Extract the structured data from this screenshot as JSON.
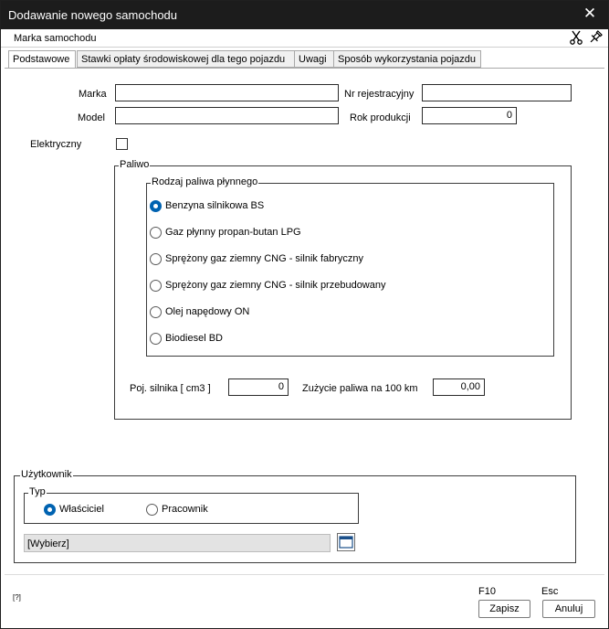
{
  "window": {
    "title": "Dodawanie nowego samochodu"
  },
  "subheader": {
    "label": "Marka samochodu"
  },
  "tabs": [
    {
      "label": "Podstawowe",
      "active": true
    },
    {
      "label": "Stawki opłaty środowiskowej dla tego pojazdu",
      "active": false
    },
    {
      "label": "Uwagi",
      "active": false
    },
    {
      "label": "Sposób wykorzystania pojazdu",
      "active": false
    }
  ],
  "form": {
    "marka_label": "Marka",
    "marka_value": "",
    "model_label": "Model",
    "model_value": "",
    "nr_rej_label": "Nr rejestracyjny",
    "nr_rej_value": "",
    "rok_label": "Rok produkcji",
    "rok_value": "0",
    "elektryczny_label": "Elektryczny",
    "elektryczny_checked": false
  },
  "paliwo": {
    "legend": "Paliwo",
    "rodzaj_legend": "Rodzaj paliwa płynnego",
    "options": [
      {
        "label": "Benzyna silnikowa BS",
        "checked": true
      },
      {
        "label": "Gaz płynny propan-butan LPG",
        "checked": false
      },
      {
        "label": "Sprężony gaz ziemny CNG - silnik fabryczny",
        "checked": false
      },
      {
        "label": "Sprężony gaz ziemny CNG - silnik przebudowany",
        "checked": false
      },
      {
        "label": "Olej napędowy ON",
        "checked": false
      },
      {
        "label": "Biodiesel BD",
        "checked": false
      }
    ],
    "poj_label": "Poj. silnika [ cm3 ]",
    "poj_value": "0",
    "zuzycie_label": "Zużycie paliwa na 100 km",
    "zuzycie_value": "0,00"
  },
  "uzytkownik": {
    "legend": "Użytkownik",
    "typ_legend": "Typ",
    "options": [
      {
        "label": "Właściciel",
        "checked": true
      },
      {
        "label": "Pracownik",
        "checked": false
      }
    ],
    "select_value": "[Wybierz]"
  },
  "footer": {
    "hint": "[?]",
    "save_hotkey": "F10",
    "save_label": "Zapisz",
    "cancel_hotkey": "Esc",
    "cancel_label": "Anuluj"
  },
  "icons": {
    "close": "close-icon",
    "scissors": "scissors-icon",
    "pin": "pin-icon",
    "picker": "window-picker-icon"
  },
  "colors": {
    "titlebar": "#1c1c1c",
    "radio_checked": "#0063b1",
    "select_bg": "#e3e3e3"
  }
}
